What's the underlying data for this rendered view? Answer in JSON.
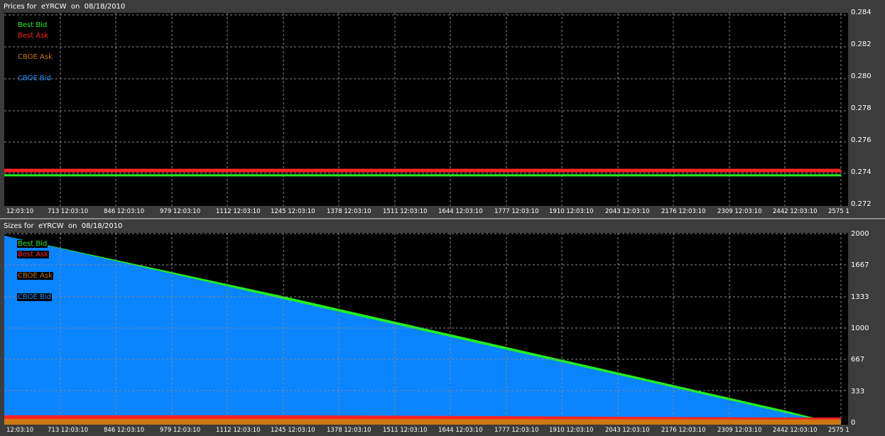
{
  "panels": {
    "prices": {
      "title": "Prices for  eYRCW  on  08/18/2010",
      "y_ticks": [
        "0.284",
        "0.282",
        "0.280",
        "0.278",
        "0.276",
        "0.274",
        "0.272"
      ]
    },
    "sizes": {
      "title": "Sizes for  eYRCW  on  08/18/2010",
      "y_ticks": [
        "2000",
        "1667",
        "1333",
        "1000",
        "667",
        "333",
        "0"
      ]
    }
  },
  "x_ticks": [
    "12:03:10",
    "713 12:03:10",
    "846 12:03:10",
    "979 12:03:10",
    "1112 12:03:10",
    "1245 12:03:10",
    "1378 12:03:10",
    "1511 12:03:10",
    "1644 12:03:10",
    "1777 12:03:10",
    "1910 12:03:10",
    "2043 12:03:10",
    "2176 12:03:10",
    "2309 12:03:10",
    "2442 12:03:10",
    "2575 1"
  ],
  "legend": [
    {
      "label": "Best Bid",
      "color": "#22ee22"
    },
    {
      "label": "Best Ask",
      "color": "#ff2222"
    },
    {
      "label": "CBOE Ask",
      "color": "#cc7711"
    },
    {
      "label": "CBOE Bid",
      "color": "#1e90ff"
    }
  ],
  "colors": {
    "background": "#000000",
    "panel": "#3c3c3c",
    "grid": "#8a8a8a",
    "best_bid": "#22ee22",
    "best_ask": "#ff2222",
    "cboe_ask": "#cc7711",
    "cboe_bid": "#0a84ff"
  },
  "chart_data": [
    {
      "type": "line",
      "title": "Prices for  eYRCW  on  08/18/2010",
      "ylim": [
        0.272,
        0.284
      ],
      "x": [
        580,
        2575
      ],
      "series": [
        {
          "name": "Best Bid",
          "values": [
            0.2739,
            0.2739
          ]
        },
        {
          "name": "Best Ask",
          "values": [
            0.2742,
            0.2742
          ]
        }
      ],
      "grid": true,
      "legend_position": "top-left"
    },
    {
      "type": "area",
      "title": "Sizes for  eYRCW  on  08/18/2010",
      "ylim": [
        0,
        2000
      ],
      "x": [
        580,
        1245,
        2442,
        2575
      ],
      "series": [
        {
          "name": "CBOE Bid",
          "values": [
            2000,
            1330,
            125,
            0
          ]
        },
        {
          "name": "Best Bid",
          "values": [
            2000,
            1360,
            150,
            0
          ]
        },
        {
          "name": "Best Ask",
          "values": [
            100,
            100,
            75,
            75
          ]
        },
        {
          "name": "CBOE Ask",
          "values": [
            60,
            60,
            55,
            55
          ]
        }
      ],
      "grid": true,
      "legend_position": "top-left"
    }
  ]
}
